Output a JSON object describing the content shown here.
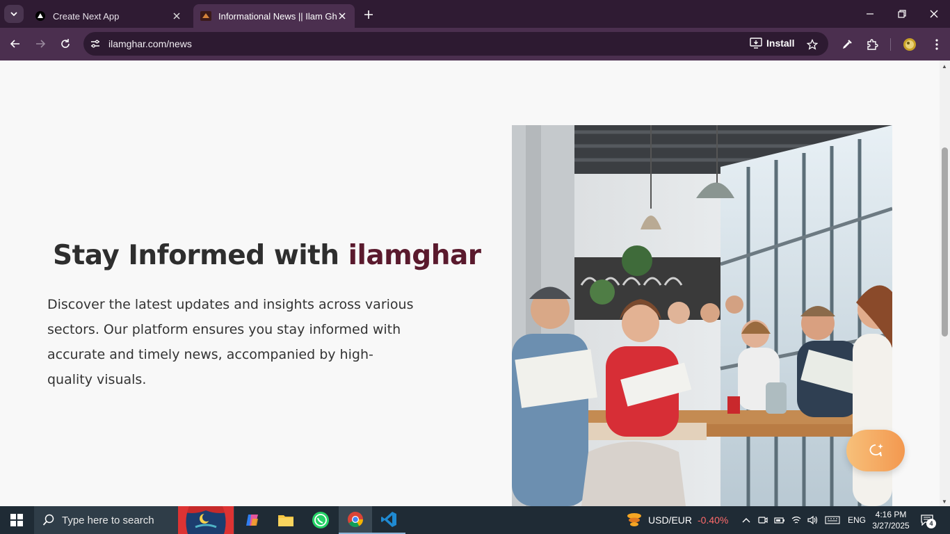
{
  "browser": {
    "tabs": [
      {
        "title": "Create Next App",
        "favicon": "nextjs-triangle-icon"
      },
      {
        "title": "Informational News || Ilam Ghar",
        "favicon": "ilamghar-logo-icon"
      }
    ],
    "url": "ilamghar.com/news",
    "install_label": "Install"
  },
  "hero": {
    "title_prefix": "Stay Informed with ",
    "title_brand": "ilamghar",
    "description": "Discover the latest updates and insights across various sectors. Our platform ensures you stay informed with accurate and timely news, accompanied by high-quality visuals.",
    "image_subject": "people reading newspapers in a bright cafe",
    "brand_color": "#5a1a2d"
  },
  "chat_button": {
    "icon": "chat-sparkle-icon",
    "colors": [
      "#f7c07a",
      "#f3984f"
    ]
  },
  "taskbar": {
    "search_placeholder": "Type here to search",
    "ticker": {
      "pair": "USD/EUR",
      "change": "-0.40%"
    },
    "language": "ENG",
    "time": "4:16 PM",
    "date": "3/27/2025",
    "notification_count": "4"
  }
}
